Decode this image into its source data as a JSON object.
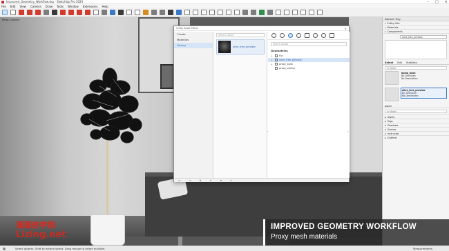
{
  "window": {
    "title": "Improved_Geometry_Workflow.skp - SketchUp Pro 2020",
    "controls": [
      "–",
      "□",
      "×"
    ]
  },
  "menu": [
    "File",
    "Edit",
    "View",
    "Camera",
    "Draw",
    "Tools",
    "Window",
    "Extensions",
    "Help"
  ],
  "viewport": {
    "scene_label": "Persp_Camera"
  },
  "dialog": {
    "title": "V-Ray Asset Editor",
    "sidebar": [
      "Create",
      "Materials",
      "Library"
    ],
    "search_placeholder": "Search Library",
    "library_item": "olive_tree_preview",
    "geometry_search_placeholder": "Search Assets",
    "geometries_header": "Geometries",
    "geometries": [
      "Fur",
      "olive_tree_preview",
      "proxy_bush",
      "proxy_cactus"
    ]
  },
  "tray": {
    "title": "Default Tray",
    "sections_top": [
      "Entity Info",
      "Materials",
      "Components"
    ],
    "component_name": "olive_tree_preview",
    "tabs": [
      "Select",
      "Edit",
      "Statistics"
    ],
    "filter_placeholder": "In Model",
    "components": [
      {
        "name": "bump_bush",
        "by": "By: Unknown",
        "desc": "No Description"
      },
      {
        "name": "olive_tree_preview",
        "by": "By: Unknown",
        "desc": "No Description"
      }
    ],
    "component_partial": "paper",
    "bottom_filter": "In Model",
    "sections_bottom": [
      "Styles",
      "Tags",
      "Shadows",
      "Scenes",
      "Instructor",
      "Outliner"
    ]
  },
  "caption": {
    "title": "IMPROVED GEOMETRY WORKFLOW",
    "subtitle": "Proxy mesh materials"
  },
  "watermark": {
    "cn_text": "溜溜自学网",
    "site": "Lizing.net"
  },
  "status": {
    "hint": "Select objects. Shift to extend select. Drag mouse to select multiple.",
    "measurements": "Measurements"
  },
  "colors": {
    "accent": "#3b78c8",
    "watermark_red": "#e0261b"
  }
}
